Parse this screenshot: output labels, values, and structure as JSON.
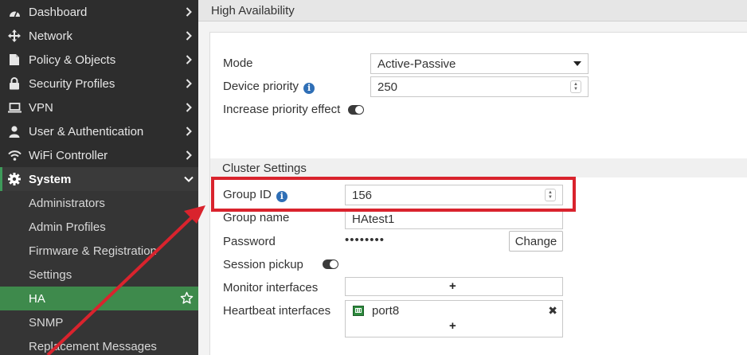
{
  "sidebar": {
    "items": [
      {
        "label": "Dashboard",
        "icon": "dashboard-icon"
      },
      {
        "label": "Network",
        "icon": "network-icon"
      },
      {
        "label": "Policy & Objects",
        "icon": "policy-icon"
      },
      {
        "label": "Security Profiles",
        "icon": "lock-icon"
      },
      {
        "label": "VPN",
        "icon": "laptop-icon"
      },
      {
        "label": "User & Authentication",
        "icon": "user-icon"
      },
      {
        "label": "WiFi Controller",
        "icon": "wifi-icon"
      },
      {
        "label": "System",
        "icon": "gear-icon"
      }
    ],
    "system_sub": [
      {
        "label": "Administrators"
      },
      {
        "label": "Admin Profiles"
      },
      {
        "label": "Firmware & Registration"
      },
      {
        "label": "Settings"
      },
      {
        "label": "HA"
      },
      {
        "label": "SNMP"
      },
      {
        "label": "Replacement Messages"
      }
    ]
  },
  "header": {
    "title": "High Availability"
  },
  "form": {
    "mode_label": "Mode",
    "mode_value": "Active-Passive",
    "priority_label": "Device priority",
    "priority_value": "250",
    "increase_label": "Increase priority effect",
    "cluster_section": "Cluster Settings",
    "group_id_label": "Group ID",
    "group_id_value": "156",
    "group_name_label": "Group name",
    "group_name_value": "HAtest1",
    "password_label": "Password",
    "password_value": "••••••••",
    "change_label": "Change",
    "session_label": "Session pickup",
    "monitor_label": "Monitor interfaces",
    "heartbeat_label": "Heartbeat interfaces",
    "heartbeat_port": "port8",
    "plus": "+",
    "remove": "✖"
  },
  "colors": {
    "sidebar_bg": "#2d2d2d",
    "active_green": "#3e8a4c",
    "highlight_red": "#d9232d",
    "info_blue": "#2f6fb6"
  }
}
